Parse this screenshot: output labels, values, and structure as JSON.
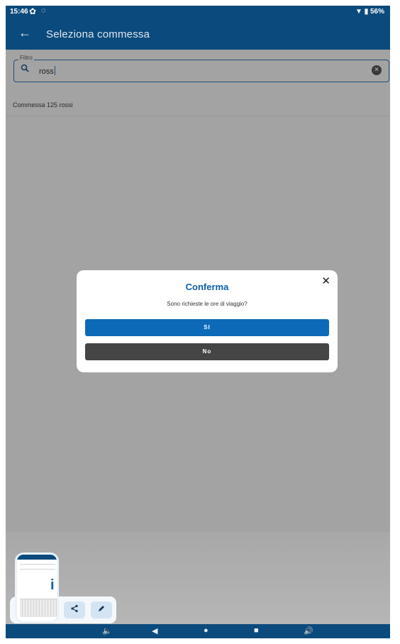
{
  "status_bar": {
    "time": "15:46",
    "settings_icon": "gear-icon",
    "sync_icon": "sync-icon",
    "battery": "56%"
  },
  "app_bar": {
    "back_icon": "arrow-left-icon",
    "title": "Seleziona commessa"
  },
  "filter": {
    "label": "Filtro",
    "value": "ross",
    "search_icon": "search-icon",
    "clear_icon": "clear-icon"
  },
  "results": [
    {
      "label": "Commessa 125 rossi"
    }
  ],
  "dialog": {
    "title": "Conferma",
    "message": "Sono richieste le ore di viaggio?",
    "yes_label": "SI",
    "no_label": "No",
    "close_icon": "close-icon"
  },
  "screenshot_toolbar": {
    "share_icon": "share-icon",
    "edit_icon": "pencil-icon"
  },
  "colors": {
    "primary": "#0b4a7c",
    "accent": "#0c6ab8",
    "dialog_title": "#0b5fa8",
    "no_button": "#454545"
  }
}
